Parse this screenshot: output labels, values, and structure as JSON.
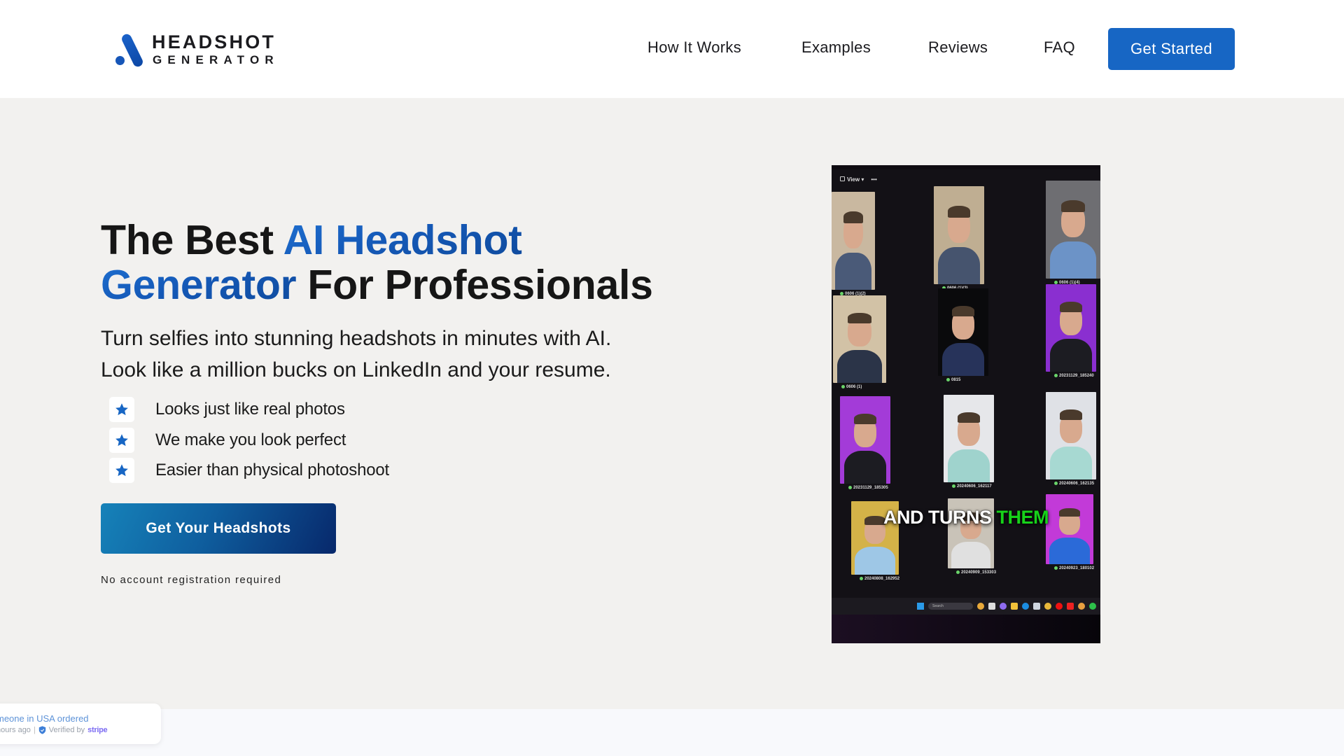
{
  "header": {
    "logo": {
      "line1": "HEADSHOT",
      "line2": "GENERATOR",
      "icon": "logo-mark-icon"
    },
    "nav": [
      {
        "label": "How It Works"
      },
      {
        "label": "Examples"
      },
      {
        "label": "Reviews"
      },
      {
        "label": "FAQ"
      }
    ],
    "cta_label": "Get Started",
    "accent_color": "#1766c4"
  },
  "hero": {
    "title": {
      "part1": "The Best ",
      "accent1": "AI Headshot",
      "accent2": "Generator",
      "part2": " For Professionals"
    },
    "subtitle": {
      "line1": "Turn selfies into stunning headshots in minutes with AI.",
      "line2": "Look like a million bucks on LinkedIn and your resume."
    },
    "bullets": [
      {
        "icon": "star-icon",
        "text": "Looks just like real photos"
      },
      {
        "icon": "star-icon",
        "text": "We make you look perfect"
      },
      {
        "icon": "star-icon",
        "text": "Easier than physical photoshoot"
      }
    ],
    "cta_label": "Get Your Headshots",
    "note": "No account registration required"
  },
  "video": {
    "toolbar": {
      "view_label": "View",
      "more_label": "•••"
    },
    "tile_labels": [
      "0606 (1)(2)",
      "0606 (1)(3)",
      "0606 (1)(4)",
      "0606 (1)",
      "0815",
      "20231129_185240",
      "20231129_185305",
      "20240606_162117",
      "20240606_162135",
      "20240808_162952",
      "20240909_153303",
      "20240923_180102"
    ],
    "caption": {
      "text": "AND TURNS ",
      "highlight": "THEM"
    },
    "taskbar_search": "Search"
  },
  "toast": {
    "line1": "meone in USA ordered",
    "line2_time": "hours ago",
    "separator": "|",
    "verified_label": "Verified by",
    "provider": "stripe"
  }
}
